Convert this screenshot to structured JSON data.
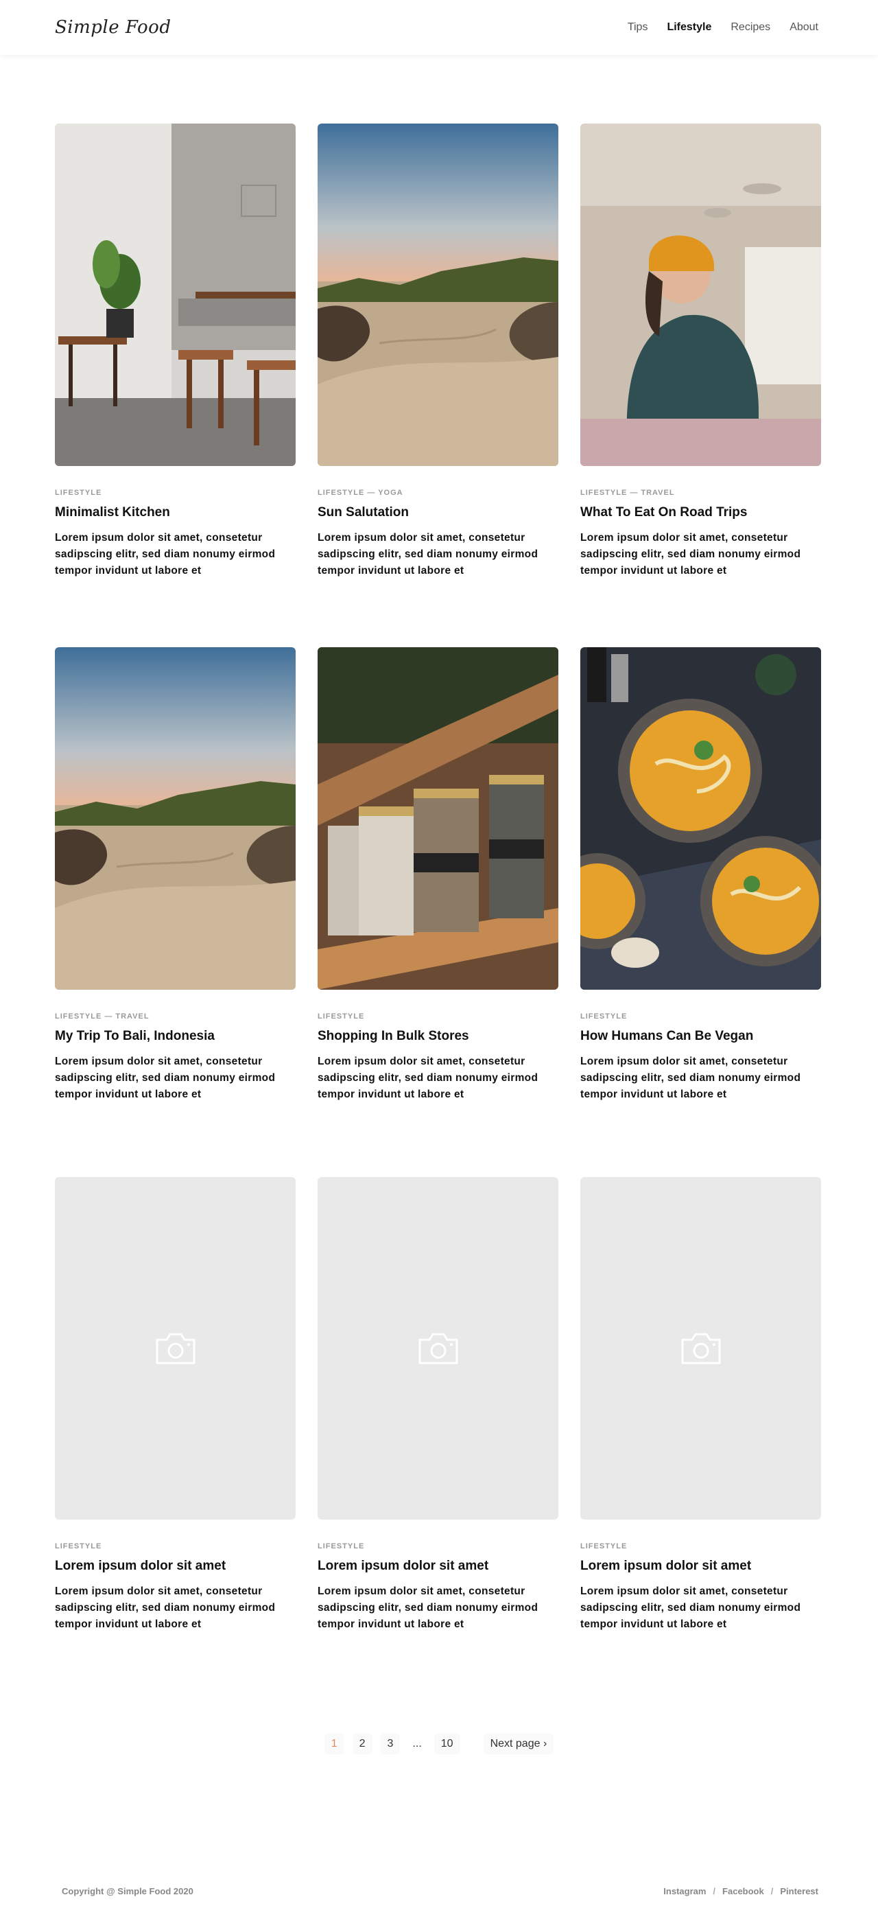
{
  "header": {
    "logo": "Simple Food",
    "nav": [
      {
        "label": "Tips",
        "active": false
      },
      {
        "label": "Lifestyle",
        "active": true
      },
      {
        "label": "Recipes",
        "active": false
      },
      {
        "label": "About",
        "active": false
      }
    ]
  },
  "posts": [
    {
      "category": "LIFESTYLE",
      "title": "Minimalist Kitchen",
      "excerpt": "Lorem ipsum dolor sit amet, consetetur sadipscing elitr, sed diam nonumy eirmod tempor invidunt ut labore et",
      "image": "kitchen"
    },
    {
      "category": "LIFESTYLE — YOGA",
      "title": "Sun Salutation",
      "excerpt": "Lorem ipsum dolor sit amet, consetetur sadipscing elitr, sed diam nonumy eirmod tempor invidunt ut labore et",
      "image": "beach"
    },
    {
      "category": "LIFESTYLE — TRAVEL",
      "title": "What To Eat On Road Trips",
      "excerpt": "Lorem ipsum dolor sit amet, consetetur sadipscing elitr, sed diam nonumy eirmod tempor invidunt ut labore et",
      "image": "roadtrip"
    },
    {
      "category": "LIFESTYLE — TRAVEL",
      "title": "My Trip To Bali, Indonesia",
      "excerpt": "Lorem ipsum dolor sit amet, consetetur sadipscing elitr, sed diam nonumy eirmod tempor invidunt ut labore et",
      "image": "beach"
    },
    {
      "category": "LIFESTYLE",
      "title": "Shopping In Bulk Stores",
      "excerpt": "Lorem ipsum dolor sit amet, consetetur sadipscing elitr, sed diam nonumy eirmod tempor invidunt ut labore et",
      "image": "jars"
    },
    {
      "category": "LIFESTYLE",
      "title": "How Humans Can Be Vegan",
      "excerpt": "Lorem ipsum dolor sit amet, consetetur sadipscing elitr, sed diam nonumy eirmod tempor invidunt ut labore et",
      "image": "soup"
    },
    {
      "category": "LIFESTYLE",
      "title": "Lorem ipsum dolor sit amet",
      "excerpt": "Lorem ipsum dolor sit amet, consetetur sadipscing elitr, sed diam nonumy eirmod tempor invidunt ut labore et",
      "image": "placeholder"
    },
    {
      "category": "LIFESTYLE",
      "title": "Lorem ipsum dolor sit amet",
      "excerpt": "Lorem ipsum dolor sit amet, consetetur sadipscing elitr, sed diam nonumy eirmod tempor invidunt ut labore et",
      "image": "placeholder"
    },
    {
      "category": "LIFESTYLE",
      "title": "Lorem ipsum dolor sit amet",
      "excerpt": "Lorem ipsum dolor sit amet, consetetur sadipscing elitr, sed diam nonumy eirmod tempor invidunt ut labore et",
      "image": "placeholder"
    }
  ],
  "pagination": {
    "pages": [
      "1",
      "2",
      "3",
      "...",
      "10"
    ],
    "current": "1",
    "next_label": "Next page"
  },
  "footer": {
    "copyright": "Copyright @ Simple Food 2020",
    "social": [
      "Instagram",
      "Facebook",
      "Pinterest"
    ],
    "separator": "/"
  },
  "colors": {
    "accent": "#e08a5a",
    "placeholder_bg": "#e9e9e9",
    "muted_text": "#999999"
  }
}
